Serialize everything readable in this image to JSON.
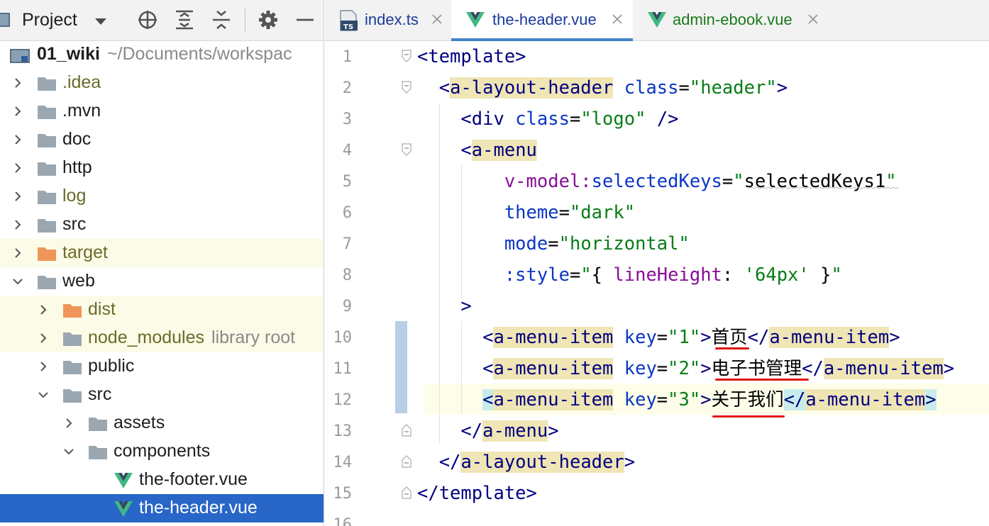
{
  "project_panel": {
    "title": "Project",
    "tree": [
      {
        "label": "01_wiki",
        "suffix": "~/Documents/workspac",
        "kind": "root",
        "depth": 0,
        "expanded": true
      },
      {
        "label": ".idea",
        "kind": "folder",
        "depth": 1,
        "expanded": false,
        "excluded": true
      },
      {
        "label": ".mvn",
        "kind": "folder",
        "depth": 1,
        "expanded": false
      },
      {
        "label": "doc",
        "kind": "folder",
        "depth": 1,
        "expanded": false
      },
      {
        "label": "http",
        "kind": "folder",
        "depth": 1,
        "expanded": false
      },
      {
        "label": "log",
        "kind": "folder",
        "depth": 1,
        "expanded": false,
        "excluded": true
      },
      {
        "label": "src",
        "kind": "folder",
        "depth": 1,
        "expanded": false
      },
      {
        "label": "target",
        "kind": "folder-orange",
        "depth": 1,
        "expanded": false,
        "excluded": true,
        "highlight": true
      },
      {
        "label": "web",
        "kind": "folder",
        "depth": 1,
        "expanded": true
      },
      {
        "label": "dist",
        "kind": "folder-orange",
        "depth": 2,
        "expanded": false,
        "excluded": true,
        "highlight": true
      },
      {
        "label": "node_modules",
        "suffix": "library root",
        "kind": "folder",
        "depth": 2,
        "expanded": false,
        "excluded": true,
        "highlight": true
      },
      {
        "label": "public",
        "kind": "folder",
        "depth": 2,
        "expanded": false
      },
      {
        "label": "src",
        "kind": "folder",
        "depth": 2,
        "expanded": true
      },
      {
        "label": "assets",
        "kind": "folder",
        "depth": 3,
        "expanded": false
      },
      {
        "label": "components",
        "kind": "folder",
        "depth": 3,
        "expanded": true
      },
      {
        "label": "the-footer.vue",
        "kind": "vue",
        "depth": 4
      },
      {
        "label": "the-header.vue",
        "kind": "vue",
        "depth": 4,
        "selected": true
      }
    ]
  },
  "tabs": [
    {
      "label": "index.ts",
      "kind": "ts",
      "active": false
    },
    {
      "label": "the-header.vue",
      "kind": "vue",
      "active": true
    },
    {
      "label": "admin-ebook.vue",
      "kind": "vue",
      "active": false
    }
  ],
  "editor": {
    "line_numbers": [
      "1",
      "2",
      "3",
      "4",
      "5",
      "6",
      "7",
      "8",
      "9",
      "10",
      "11",
      "12",
      "13",
      "14",
      "15",
      "16"
    ],
    "current_line": 12,
    "lines": [
      "<template>",
      "  <a-layout-header class=\"header\">",
      "    <div class=\"logo\" />",
      "    <a-menu",
      "        v-model:selectedKeys=\"selectedKeys1\"",
      "        theme=\"dark\"",
      "        mode=\"horizontal\"",
      "        :style=\"{ lineHeight: '64px' }\"",
      "    >",
      "      <a-menu-item key=\"1\">首页</a-menu-item>",
      "      <a-menu-item key=\"2\">电子书管理</a-menu-item>",
      "      <a-menu-item key=\"3\">关于我们</a-menu-item>",
      "    </a-menu>",
      "  </a-layout-header>",
      "</template>",
      ""
    ]
  },
  "colors": {
    "selection": "#2866c7",
    "tag": "#000080",
    "attribute": "#0b36c5",
    "string": "#067d17",
    "property": "#871094",
    "tag_highlight": "#efe5b5",
    "annotation_underline": "#e01414"
  }
}
